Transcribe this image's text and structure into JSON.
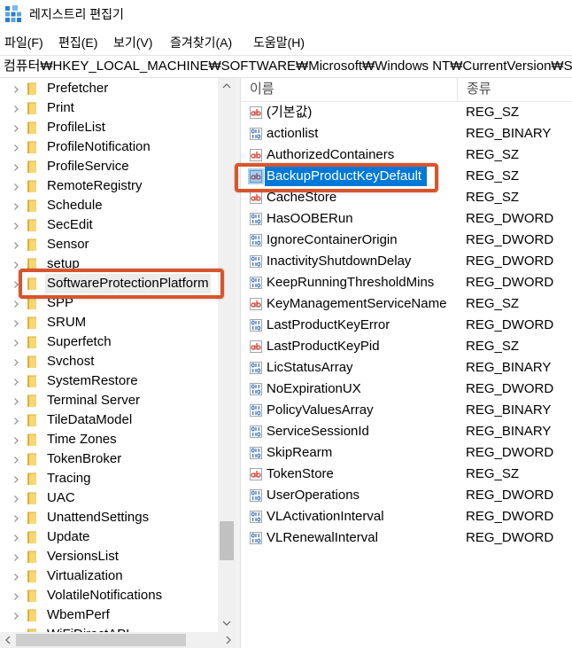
{
  "window": {
    "title": "레지스트리 편집기",
    "icon": "registry-editor-icon"
  },
  "menu": [
    {
      "label": "파일(F)"
    },
    {
      "label": "편집(E)"
    },
    {
      "label": "보기(V)"
    },
    {
      "label": "즐겨찾기(A)"
    },
    {
      "label": "도움말(H)"
    }
  ],
  "address": {
    "path": "컴퓨터₩HKEY_LOCAL_MACHINE₩SOFTWARE₩Microsoft₩Windows NT₩CurrentVersion₩Softwa"
  },
  "tree": {
    "expand_icon": "chevron-right-icon",
    "node_icon": "folder-icon",
    "items": [
      {
        "label": "Prefetcher"
      },
      {
        "label": "Print"
      },
      {
        "label": "ProfileList"
      },
      {
        "label": "ProfileNotification"
      },
      {
        "label": "ProfileService"
      },
      {
        "label": "RemoteRegistry"
      },
      {
        "label": "Schedule"
      },
      {
        "label": "SecEdit"
      },
      {
        "label": "Sensor"
      },
      {
        "label": "setup"
      },
      {
        "label": "SoftwareProtectionPlatform",
        "selected": true
      },
      {
        "label": "SPP"
      },
      {
        "label": "SRUM"
      },
      {
        "label": "Superfetch"
      },
      {
        "label": "Svchost"
      },
      {
        "label": "SystemRestore"
      },
      {
        "label": "Terminal Server"
      },
      {
        "label": "TileDataModel"
      },
      {
        "label": "Time Zones"
      },
      {
        "label": "TokenBroker"
      },
      {
        "label": "Tracing"
      },
      {
        "label": "UAC"
      },
      {
        "label": "UnattendSettings"
      },
      {
        "label": "Update"
      },
      {
        "label": "VersionsList"
      },
      {
        "label": "Virtualization"
      },
      {
        "label": "VolatileNotifications"
      },
      {
        "label": "WbemPerf"
      },
      {
        "label": "WiFiDirectAPI"
      }
    ]
  },
  "values": {
    "columns": {
      "name": "이름",
      "type": "종류"
    },
    "rows": [
      {
        "name": "(기본값)",
        "type": "REG_SZ",
        "icon": "string-value-icon"
      },
      {
        "name": "actionlist",
        "type": "REG_BINARY",
        "icon": "binary-value-icon"
      },
      {
        "name": "AuthorizedContainers",
        "type": "REG_SZ",
        "icon": "string-value-icon"
      },
      {
        "name": "BackupProductKeyDefault",
        "type": "REG_SZ",
        "icon": "string-value-icon",
        "selected": true
      },
      {
        "name": "CacheStore",
        "type": "REG_SZ",
        "icon": "string-value-icon"
      },
      {
        "name": "HasOOBERun",
        "type": "REG_DWORD",
        "icon": "binary-value-icon"
      },
      {
        "name": "IgnoreContainerOrigin",
        "type": "REG_DWORD",
        "icon": "binary-value-icon"
      },
      {
        "name": "InactivityShutdownDelay",
        "type": "REG_DWORD",
        "icon": "binary-value-icon"
      },
      {
        "name": "KeepRunningThresholdMins",
        "type": "REG_DWORD",
        "icon": "binary-value-icon"
      },
      {
        "name": "KeyManagementServiceName",
        "type": "REG_SZ",
        "icon": "string-value-icon"
      },
      {
        "name": "LastProductKeyError",
        "type": "REG_DWORD",
        "icon": "binary-value-icon"
      },
      {
        "name": "LastProductKeyPid",
        "type": "REG_SZ",
        "icon": "string-value-icon"
      },
      {
        "name": "LicStatusArray",
        "type": "REG_BINARY",
        "icon": "binary-value-icon"
      },
      {
        "name": "NoExpirationUX",
        "type": "REG_DWORD",
        "icon": "binary-value-icon"
      },
      {
        "name": "PolicyValuesArray",
        "type": "REG_BINARY",
        "icon": "binary-value-icon"
      },
      {
        "name": "ServiceSessionId",
        "type": "REG_BINARY",
        "icon": "binary-value-icon"
      },
      {
        "name": "SkipRearm",
        "type": "REG_DWORD",
        "icon": "binary-value-icon"
      },
      {
        "name": "TokenStore",
        "type": "REG_SZ",
        "icon": "string-value-icon"
      },
      {
        "name": "UserOperations",
        "type": "REG_DWORD",
        "icon": "binary-value-icon"
      },
      {
        "name": "VLActivationInterval",
        "type": "REG_DWORD",
        "icon": "binary-value-icon"
      },
      {
        "name": "VLRenewalInterval",
        "type": "REG_DWORD",
        "icon": "binary-value-icon"
      }
    ]
  },
  "colors": {
    "selection": "#0078d7",
    "annotation": "#d9542b",
    "folder": "#f8d672",
    "folder_back": "#dfae3d",
    "string_icon": "#d83b2a",
    "binary_icon": "#1f5bb4"
  }
}
